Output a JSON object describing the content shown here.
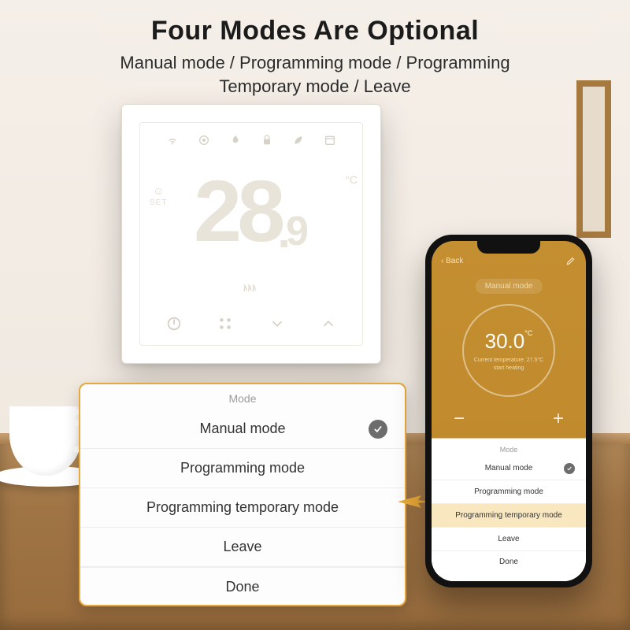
{
  "headline": "Four Modes Are Optional",
  "subhead_line1": "Manual mode / Programming mode / Programming",
  "subhead_line2": "Temporary mode / Leave",
  "thermostat": {
    "big": "28",
    "decimal": "9",
    "unit": "°C",
    "set_label": "SET"
  },
  "modes": {
    "title": "Mode",
    "items": [
      "Manual mode",
      "Programming mode",
      "Programming temporary mode",
      "Leave"
    ],
    "selected_index": 0,
    "done": "Done"
  },
  "phone": {
    "back": "Back",
    "tag": "Manual mode",
    "temp": "30.0",
    "unit": "°C",
    "current": "Current temperature: 27.5°C",
    "status": "start heating",
    "minus": "−",
    "plus": "+",
    "modes_title": "Mode",
    "items": [
      "Manual mode",
      "Programming mode",
      "Programming temporary mode",
      "Leave"
    ],
    "selected_index": 0,
    "highlight_index": 2,
    "done": "Done"
  }
}
